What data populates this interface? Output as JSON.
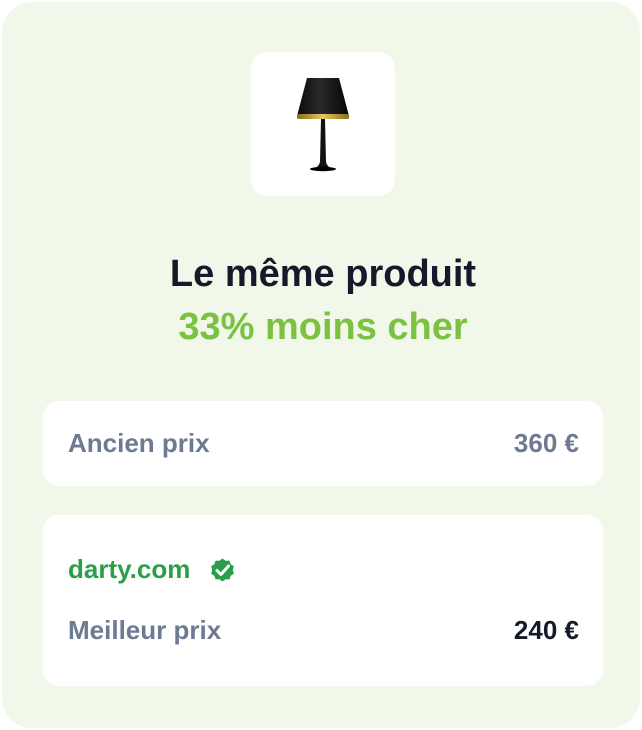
{
  "product": {
    "image_icon": "table-lamp-icon"
  },
  "headline": {
    "line1": "Le même produit",
    "line2": "33% moins cher"
  },
  "old_price": {
    "label": "Ancien prix",
    "value": "360 €"
  },
  "best_offer": {
    "retailer": "darty.com",
    "verified_icon": "check-badge-icon",
    "label": "Meilleur prix",
    "value": "240 €"
  },
  "colors": {
    "card_background": "#f1f7e9",
    "accent_green": "#7cc242",
    "retailer_green": "#2a9f49",
    "muted_text": "#6e7a92",
    "dark_text": "#141a2a"
  }
}
